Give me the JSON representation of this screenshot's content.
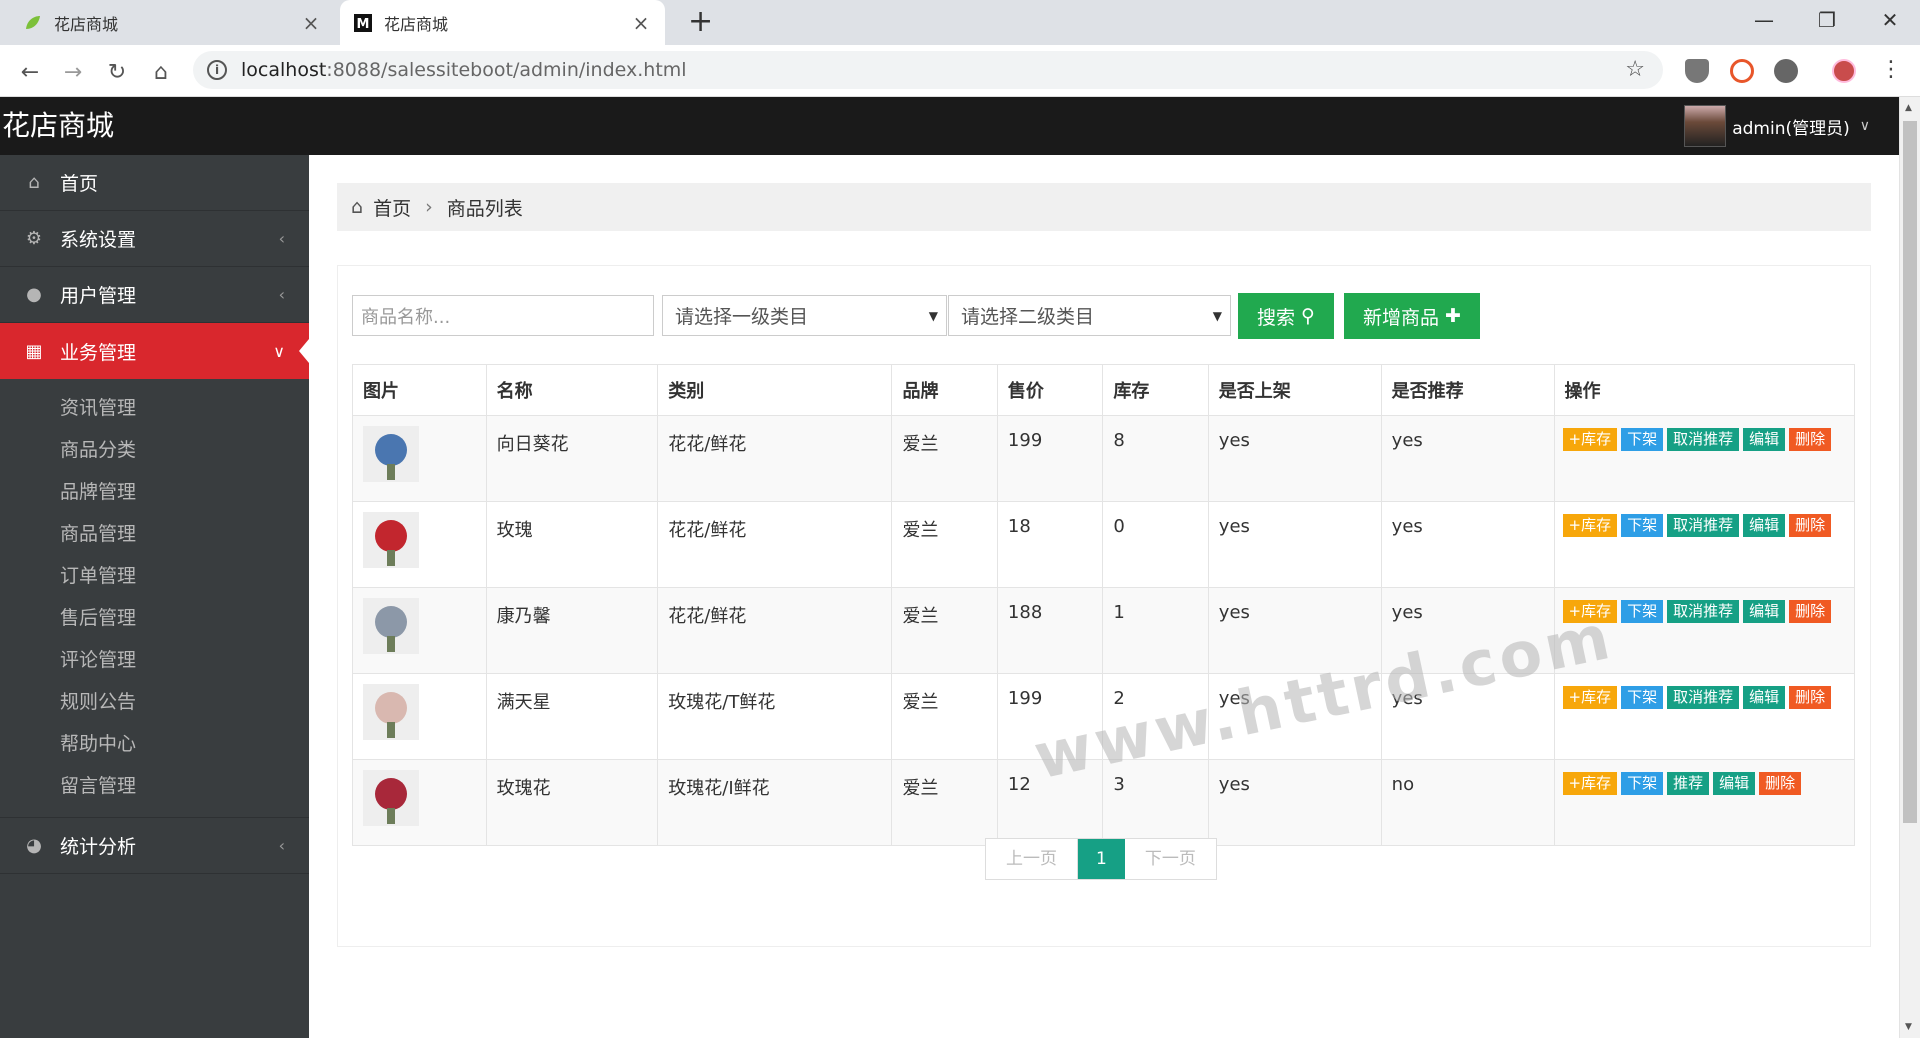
{
  "browser": {
    "tabs": [
      {
        "title": "花店商城",
        "close": "×"
      },
      {
        "title": "花店商城",
        "close": "×"
      }
    ],
    "new_tab": "+",
    "window": {
      "min": "—",
      "max": "❐",
      "close": "✕"
    },
    "url_host": "localhost",
    "url_path": ":8088/salessiteboot/admin/index.html"
  },
  "header": {
    "brand": "花店商城",
    "user": "admin(管理员)"
  },
  "sidebar": {
    "items": [
      {
        "label": "首页",
        "icon": "home-icon"
      },
      {
        "label": "系统设置",
        "icon": "gears-icon"
      },
      {
        "label": "用户管理",
        "icon": "user-icon"
      },
      {
        "label": "业务管理",
        "icon": "grid-icon"
      }
    ],
    "sub_items": [
      "资讯管理",
      "商品分类",
      "品牌管理",
      "商品管理",
      "订单管理",
      "售后管理",
      "评论管理",
      "规则公告",
      "帮助中心",
      "留言管理"
    ],
    "bottom": {
      "label": "统计分析",
      "icon": "dashboard-icon"
    }
  },
  "breadcrumb": {
    "home": "首页",
    "current": "商品列表"
  },
  "toolbar": {
    "search_placeholder": "商品名称...",
    "select_1": "请选择一级类目",
    "select_2": "请选择二级类目",
    "search_label": "搜索",
    "add_label": "新增商品"
  },
  "table": {
    "headers": [
      "图片",
      "名称",
      "类别",
      "品牌",
      "售价",
      "库存",
      "是否上架",
      "是否推荐",
      "操作"
    ],
    "rows": [
      {
        "name": "向日葵花",
        "category": "花花/鲜花",
        "brand": "爱兰",
        "price": "199",
        "stock": "8",
        "on_sale": "yes",
        "recommended": "yes",
        "ops": [
          "+库存",
          "下架",
          "取消推荐",
          "编辑",
          "删除"
        ],
        "color": "#4a76b0"
      },
      {
        "name": "玫瑰",
        "category": "花花/鲜花",
        "brand": "爱兰",
        "price": "18",
        "stock": "0",
        "on_sale": "yes",
        "recommended": "yes",
        "ops": [
          "+库存",
          "下架",
          "取消推荐",
          "编辑",
          "删除"
        ],
        "color": "#c2262e"
      },
      {
        "name": "康乃馨",
        "category": "花花/鲜花",
        "brand": "爱兰",
        "price": "188",
        "stock": "1",
        "on_sale": "yes",
        "recommended": "yes",
        "ops": [
          "+库存",
          "下架",
          "取消推荐",
          "编辑",
          "删除"
        ],
        "color": "#8c98a8"
      },
      {
        "name": "满天星",
        "category": "玫瑰花/T鲜花",
        "brand": "爱兰",
        "price": "199",
        "stock": "2",
        "on_sale": "yes",
        "recommended": "yes",
        "ops": [
          "+库存",
          "下架",
          "取消推荐",
          "编辑",
          "删除"
        ],
        "color": "#d9b8b0"
      },
      {
        "name": "玫瑰花",
        "category": "玫瑰花/I鲜花",
        "brand": "爱兰",
        "price": "12",
        "stock": "3",
        "on_sale": "yes",
        "recommended": "no",
        "ops": [
          "+库存",
          "下架",
          "推荐",
          "编辑",
          "删除"
        ],
        "color": "#a8283a"
      }
    ]
  },
  "pager": {
    "prev": "上一页",
    "current": "1",
    "next": "下一页"
  },
  "watermark": "www.httrd.com"
}
